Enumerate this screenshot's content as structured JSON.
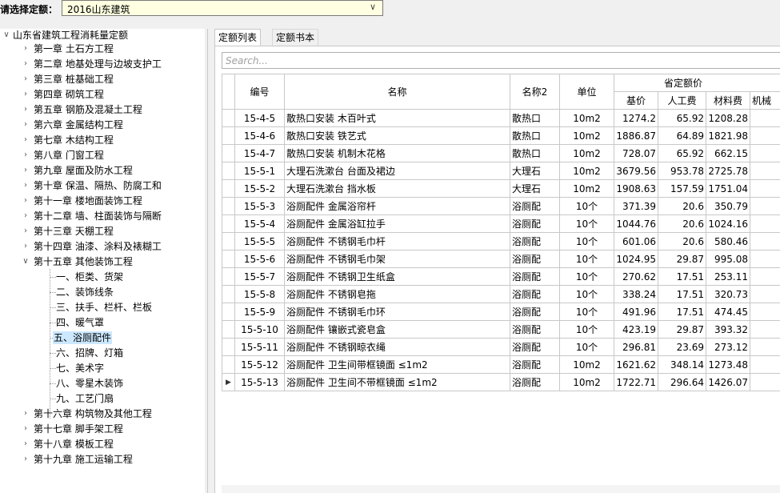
{
  "quota_selector": {
    "label": "请选择定额：",
    "value": "2016山东建筑",
    "arrow_glyph": "∨"
  },
  "tree": {
    "root": "山东省建筑工程消耗量定额",
    "chapters": [
      {
        "label": "第一章 土石方工程"
      },
      {
        "label": "第二章 地基处理与边坡支护工"
      },
      {
        "label": "第三章 桩基础工程"
      },
      {
        "label": "第四章 砌筑工程"
      },
      {
        "label": "第五章 钢筋及混凝土工程"
      },
      {
        "label": "第六章 金属结构工程"
      },
      {
        "label": "第七章 木结构工程"
      },
      {
        "label": "第八章 门窗工程"
      },
      {
        "label": "第九章 屋面及防水工程"
      },
      {
        "label": "第十章 保温、隔热、防腐工和"
      },
      {
        "label": "第十一章 楼地面装饰工程"
      },
      {
        "label": "第十二章 墙、柱面装饰与隔断"
      },
      {
        "label": "第十三章 天棚工程"
      },
      {
        "label": "第十四章 油漆、涂料及裱糊工"
      },
      {
        "label": "第十五章 其他装饰工程"
      },
      {
        "label": "第十六章 构筑物及其他工程"
      },
      {
        "label": "第十七章 脚手架工程"
      },
      {
        "label": "第十八章 模板工程"
      },
      {
        "label": "第十九章 施工运输工程"
      }
    ],
    "sections": [
      {
        "label": "一、柜类、货架"
      },
      {
        "label": "二、装饰线条"
      },
      {
        "label": "三、扶手、栏杆、栏板"
      },
      {
        "label": "四、暖气罩"
      },
      {
        "label": "五、浴厕配件"
      },
      {
        "label": "六、招牌、灯箱"
      },
      {
        "label": "七、美术字"
      },
      {
        "label": "八、零星木装饰"
      },
      {
        "label": "九、工艺门扇"
      }
    ],
    "expanded_glyph": "∨",
    "collapsed_glyph": "›",
    "selected_section": "五、浴厕配件"
  },
  "tabs": [
    {
      "label": "定额列表"
    },
    {
      "label": "定额书本"
    }
  ],
  "search": {
    "placeholder": "Search..."
  },
  "table": {
    "headers": {
      "code": "编号",
      "name": "名称",
      "name2": "名称2",
      "unit": "单位",
      "group": "省定额价",
      "base": "基价",
      "labor": "人工费",
      "material": "材料费",
      "machine": "机械"
    },
    "current_row_marker": "▶",
    "rows": [
      {
        "code": "15-4-5",
        "name": "散热口安装 木百叶式",
        "name2": "散热口",
        "unit": "10m2",
        "base": "1274.2",
        "labor": "65.92",
        "material": "1208.28"
      },
      {
        "code": "15-4-6",
        "name": "散热口安装 铁艺式",
        "name2": "散热口",
        "unit": "10m2",
        "base": "1886.87",
        "labor": "64.89",
        "material": "1821.98"
      },
      {
        "code": "15-4-7",
        "name": "散热口安装 机制木花格",
        "name2": "散热口",
        "unit": "10m2",
        "base": "728.07",
        "labor": "65.92",
        "material": "662.15"
      },
      {
        "code": "15-5-1",
        "name": "大理石洗漱台 台面及裙边",
        "name2": "大理石",
        "unit": "10m2",
        "base": "3679.56",
        "labor": "953.78",
        "material": "2725.78"
      },
      {
        "code": "15-5-2",
        "name": "大理石洗漱台 挡水板",
        "name2": "大理石",
        "unit": "10m2",
        "base": "1908.63",
        "labor": "157.59",
        "material": "1751.04"
      },
      {
        "code": "15-5-3",
        "name": "浴厕配件 金属浴帘杆",
        "name2": "浴厕配",
        "unit": "10个",
        "base": "371.39",
        "labor": "20.6",
        "material": "350.79"
      },
      {
        "code": "15-5-4",
        "name": "浴厕配件 金属浴缸拉手",
        "name2": "浴厕配",
        "unit": "10个",
        "base": "1044.76",
        "labor": "20.6",
        "material": "1024.16"
      },
      {
        "code": "15-5-5",
        "name": "浴厕配件 不锈钢毛巾杆",
        "name2": "浴厕配",
        "unit": "10个",
        "base": "601.06",
        "labor": "20.6",
        "material": "580.46"
      },
      {
        "code": "15-5-6",
        "name": "浴厕配件 不锈钢毛巾架",
        "name2": "浴厕配",
        "unit": "10个",
        "base": "1024.95",
        "labor": "29.87",
        "material": "995.08"
      },
      {
        "code": "15-5-7",
        "name": "浴厕配件 不锈钢卫生纸盒",
        "name2": "浴厕配",
        "unit": "10个",
        "base": "270.62",
        "labor": "17.51",
        "material": "253.11"
      },
      {
        "code": "15-5-8",
        "name": "浴厕配件 不锈钢皂拖",
        "name2": "浴厕配",
        "unit": "10个",
        "base": "338.24",
        "labor": "17.51",
        "material": "320.73"
      },
      {
        "code": "15-5-9",
        "name": "浴厕配件 不锈钢毛巾环",
        "name2": "浴厕配",
        "unit": "10个",
        "base": "491.96",
        "labor": "17.51",
        "material": "474.45"
      },
      {
        "code": "15-5-10",
        "name": "浴厕配件 镶嵌式瓷皂盒",
        "name2": "浴厕配",
        "unit": "10个",
        "base": "423.19",
        "labor": "29.87",
        "material": "393.32"
      },
      {
        "code": "15-5-11",
        "name": "浴厕配件 不锈钢晾衣绳",
        "name2": "浴厕配",
        "unit": "10个",
        "base": "296.81",
        "labor": "23.69",
        "material": "273.12"
      },
      {
        "code": "15-5-12",
        "name": "浴厕配件 卫生间带框镜面 ≤1m2",
        "name2": "浴厕配",
        "unit": "10m2",
        "base": "1621.62",
        "labor": "348.14",
        "material": "1273.48"
      },
      {
        "code": "15-5-13",
        "name": "浴厕配件 卫生间不带框镜面 ≤1m2",
        "name2": "浴厕配",
        "unit": "10m2",
        "base": "1722.71",
        "labor": "296.64",
        "material": "1426.07"
      }
    ]
  },
  "colors": {
    "selector_bg": "#ffffe1",
    "selection_bg": "#cce8ff",
    "grid_line": "#c8c8c8"
  }
}
